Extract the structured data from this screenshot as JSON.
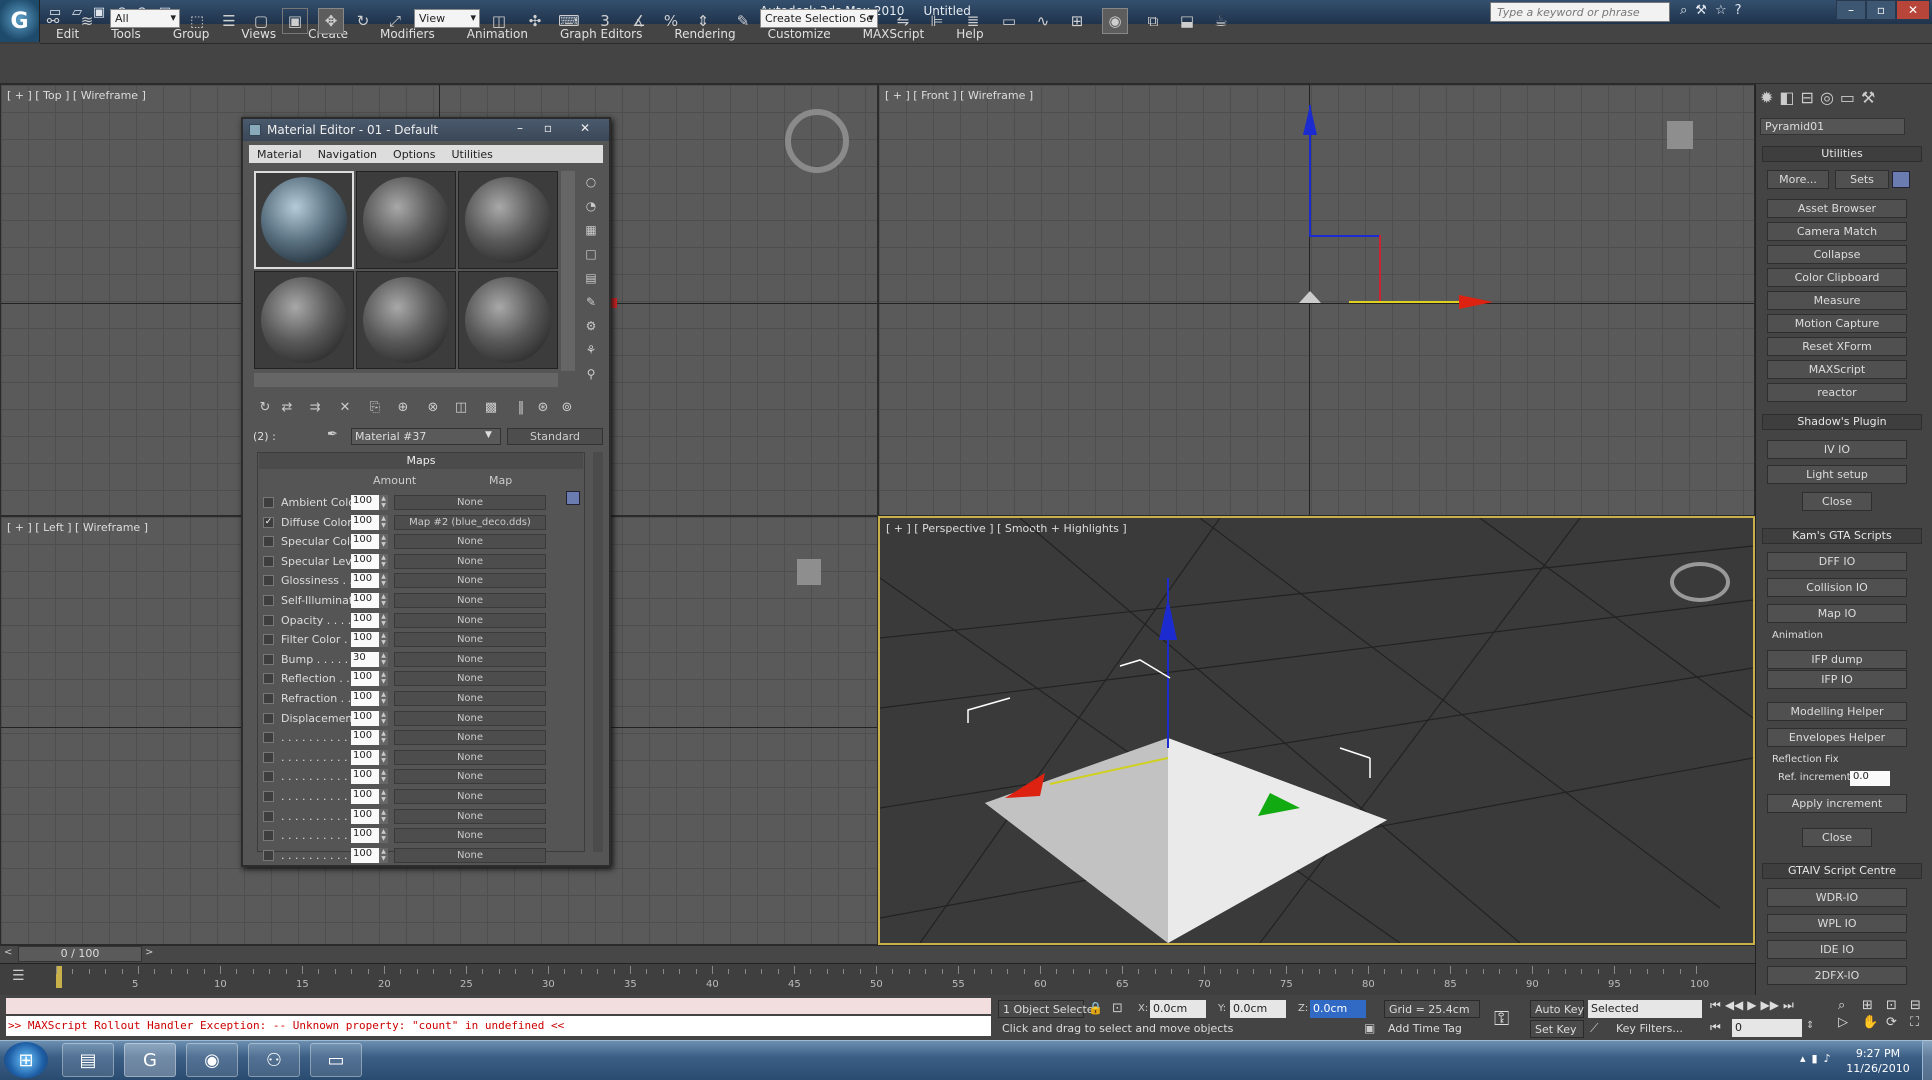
{
  "window": {
    "title": "Autodesk 3ds Max 2010",
    "doc": "Untitled",
    "search_placeholder": "Type a keyword or phrase"
  },
  "menu": [
    "Edit",
    "Tools",
    "Group",
    "Views",
    "Create",
    "Modifiers",
    "Animation",
    "Graph Editors",
    "Rendering",
    "Customize",
    "MAXScript",
    "Help"
  ],
  "toolbar": {
    "filter": "All",
    "ref_coord": "View",
    "selection_set": "Create Selection Se"
  },
  "viewports": {
    "top": "[ + ] [ Top ] [ Wireframe ]",
    "front": "[ + ] [ Front ] [ Wireframe ]",
    "left": "[ + ] [ Left ] [ Wireframe ]",
    "persp": "[ + ] [ Perspective ] [ Smooth + Highlights ]"
  },
  "material_editor": {
    "title": "Material Editor - 01 - Default",
    "menu": [
      "Material",
      "Navigation",
      "Options",
      "Utilities"
    ],
    "slot_id": "(2) :",
    "material_name": "Material #37",
    "material_type": "Standard",
    "maps_header": "Maps",
    "col_amount": "Amount",
    "col_map": "Map",
    "rows": [
      {
        "name": "Ambient Color . .",
        "amount": "100",
        "map": "None",
        "checked": false
      },
      {
        "name": "Diffuse Color . . .",
        "amount": "100",
        "map": "Map #2 (blue_deco.dds)",
        "checked": true
      },
      {
        "name": "Specular Color  .",
        "amount": "100",
        "map": "None",
        "checked": false
      },
      {
        "name": "Specular Level  .",
        "amount": "100",
        "map": "None",
        "checked": false
      },
      {
        "name": "Glossiness . . . .",
        "amount": "100",
        "map": "None",
        "checked": false
      },
      {
        "name": "Self-Illumination .",
        "amount": "100",
        "map": "None",
        "checked": false
      },
      {
        "name": "Opacity . . . . . .",
        "amount": "100",
        "map": "None",
        "checked": false
      },
      {
        "name": "Filter Color  . . .",
        "amount": "100",
        "map": "None",
        "checked": false
      },
      {
        "name": "Bump  . . . . . . .",
        "amount": "30",
        "map": "None",
        "checked": false
      },
      {
        "name": "Reflection  . . . .",
        "amount": "100",
        "map": "None",
        "checked": false
      },
      {
        "name": "Refraction  . . . .",
        "amount": "100",
        "map": "None",
        "checked": false
      },
      {
        "name": "Displacement . .",
        "amount": "100",
        "map": "None",
        "checked": false
      },
      {
        "name": ". . . . . . . . . . .",
        "amount": "100",
        "map": "None",
        "checked": false
      },
      {
        "name": ". . . . . . . . . . .",
        "amount": "100",
        "map": "None",
        "checked": false
      },
      {
        "name": ". . . . . . . . . . .",
        "amount": "100",
        "map": "None",
        "checked": false
      },
      {
        "name": ". . . . . . . . . . .",
        "amount": "100",
        "map": "None",
        "checked": false
      },
      {
        "name": ". . . . . . . . . . .",
        "amount": "100",
        "map": "None",
        "checked": false
      },
      {
        "name": ". . . . . . . . . . .",
        "amount": "100",
        "map": "None",
        "checked": false
      },
      {
        "name": ". . . . . . . . . . .",
        "amount": "100",
        "map": "None",
        "checked": false
      }
    ]
  },
  "cmdpanel": {
    "object_name": "Pyramid01",
    "utilities_header": "Utilities",
    "more_label": "More...",
    "sets_label": "Sets",
    "utilities": [
      "Asset Browser",
      "Camera Match",
      "Collapse",
      "Color Clipboard",
      "Measure",
      "Motion Capture",
      "Reset XForm",
      "MAXScript",
      "reactor"
    ],
    "shadow_header": "Shadow's Plugin",
    "shadow_items": [
      "IV IO",
      "Light setup",
      "Close"
    ],
    "kam_header": "Kam's GTA Scripts",
    "kam_items": [
      "DFF IO",
      "Collision IO",
      "Map IO"
    ],
    "animation_label": "Animation",
    "anim_items": [
      "IFP dump",
      "IFP IO"
    ],
    "helper_items": [
      "Modelling Helper",
      "Envelopes Helper"
    ],
    "reflection_label": "Reflection Fix",
    "ref_increment_label": "Ref. increment",
    "ref_increment_value": "0.0",
    "apply_label": "Apply increment",
    "close_label": "Close",
    "gtaiv_header": "GTAIV Script Centre",
    "gtaiv_items": [
      "WDR-IO",
      "WPL IO",
      "IDE IO",
      "2DFX-IO"
    ]
  },
  "timeline": {
    "frame": "0 / 100",
    "ticks": [
      "5",
      "10",
      "15",
      "20",
      "25",
      "30",
      "35",
      "40",
      "45",
      "50",
      "55",
      "60",
      "65",
      "70",
      "75",
      "80",
      "85",
      "90",
      "95",
      "100"
    ]
  },
  "status": {
    "error": ">> MAXScript Rollout Handler Exception: -- Unknown property: \"count\" in undefined <<",
    "selected": "1 Object Selecte",
    "prompt": "Click and drag to select and move objects",
    "x_label": "X:",
    "x": "0.0cm",
    "y_label": "Y:",
    "y": "0.0cm",
    "z_label": "Z:",
    "z": "0.0cm",
    "grid": "Grid = 25.4cm",
    "add_time_tag": "Add Time Tag",
    "auto_key": "Auto Key",
    "set_key": "Set Key",
    "key_mode": "Selected",
    "key_filters": "Key Filters...",
    "frame_field": "0"
  },
  "taskbar": {
    "time": "9:27 PM",
    "date": "11/26/2010"
  }
}
